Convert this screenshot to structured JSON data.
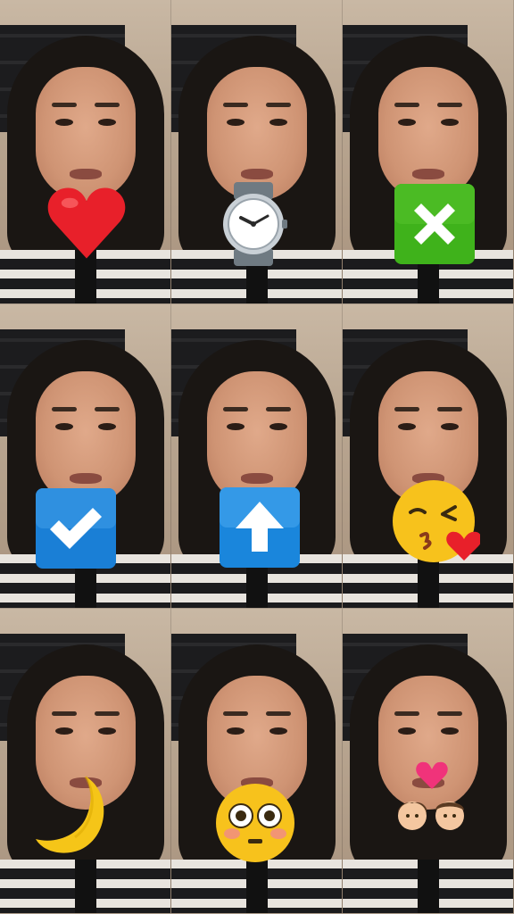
{
  "grid": {
    "columns": 3,
    "rows": 3,
    "tiles": [
      {
        "overlay": "red-heart-icon"
      },
      {
        "overlay": "wristwatch-icon"
      },
      {
        "overlay": "cross-mark-button-icon"
      },
      {
        "overlay": "check-mark-button-icon"
      },
      {
        "overlay": "up-arrow-button-icon"
      },
      {
        "overlay": "face-blowing-kiss-icon"
      },
      {
        "overlay": "crescent-moon-icon"
      },
      {
        "overlay": "flushed-face-icon"
      },
      {
        "overlay": "kiss-couple-icon"
      }
    ]
  },
  "colors": {
    "heart": "#e8202a",
    "cross_box": "#3fb21b",
    "check_box": "#1a7fd6",
    "up_box": "#1a86dc",
    "emoji_yellow": "#f7c21c"
  }
}
